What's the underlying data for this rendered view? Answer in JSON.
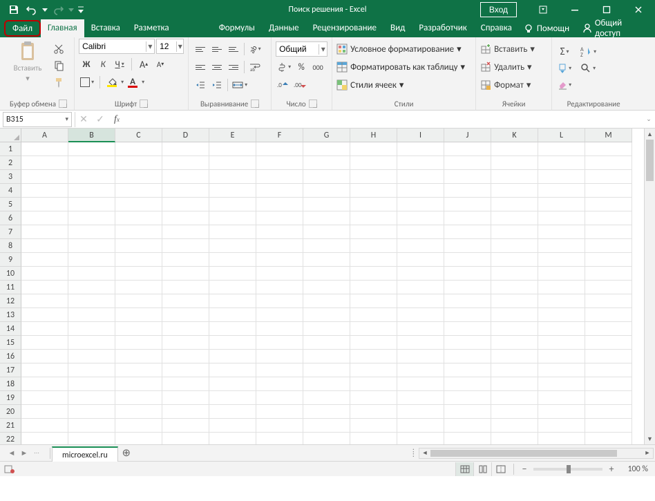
{
  "titlebar": {
    "doc_title": "Поиск решения",
    "sep": "  -  ",
    "app_name": "Excel",
    "login": "Вход"
  },
  "tabs": {
    "file": "Файл",
    "items": [
      "Главная",
      "Вставка",
      "Разметка страницы",
      "Формулы",
      "Данные",
      "Рецензирование",
      "Вид",
      "Разработчик",
      "Справка"
    ],
    "active_index": 0,
    "help": "Помощн",
    "share": "Общий доступ"
  },
  "ribbon": {
    "clipboard": {
      "paste": "Вставить",
      "label": "Буфер обмена"
    },
    "font": {
      "family": "Calibri",
      "size": "12",
      "label": "Шрифт",
      "bold": "Ж",
      "italic": "К",
      "under": "Ч"
    },
    "align": {
      "label": "Выравнивание",
      "wrap": "ab"
    },
    "number": {
      "format": "Общий",
      "label": "Число",
      "pct": "%",
      "comma": "000"
    },
    "styles": {
      "cond": "Условное форматирование",
      "table": "Форматировать как таблицу",
      "cell": "Стили ячеек",
      "label": "Стили"
    },
    "cells": {
      "insert": "Вставить",
      "delete": "Удалить",
      "format": "Формат",
      "label": "Ячейки"
    },
    "editing": {
      "label": "Редактирование"
    }
  },
  "formula_bar": {
    "namebox": "B315"
  },
  "grid": {
    "columns": [
      "A",
      "B",
      "C",
      "D",
      "E",
      "F",
      "G",
      "H",
      "I",
      "J",
      "K",
      "L",
      "M"
    ],
    "active_col_index": 1,
    "rows": 22
  },
  "sheets": {
    "active": "microexcel.ru"
  },
  "status": {
    "zoom": "100 %"
  }
}
